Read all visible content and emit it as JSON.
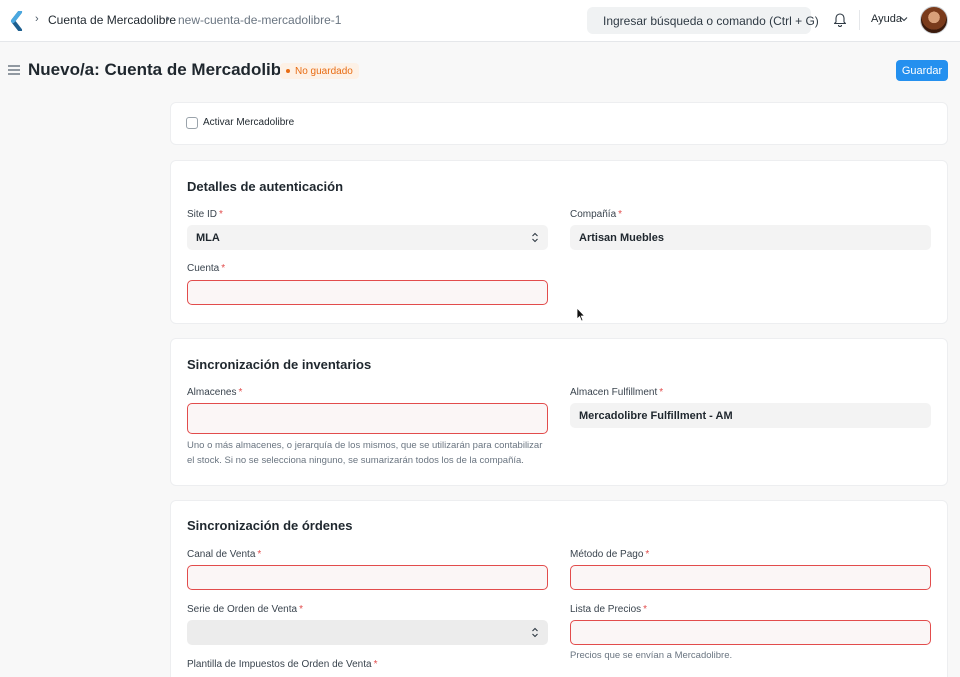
{
  "navbar": {
    "breadcrumbs": [
      "Cuenta de Mercadolibre",
      "new-cuenta-de-mercadolibre-1"
    ],
    "search_placeholder": "Ingresar búsqueda o comando (Ctrl + G)",
    "help_label": "Ayuda"
  },
  "header": {
    "title": "Nuevo/a: Cuenta de Mercadolibre",
    "status": "No guardado",
    "save_label": "Guardar"
  },
  "activate": {
    "label": "Activar Mercadolibre",
    "checked": false
  },
  "auth_section": {
    "title": "Detalles de autenticación",
    "site_id": {
      "label": "Site ID",
      "value": "MLA"
    },
    "company": {
      "label": "Compañía",
      "value": "Artisan Muebles"
    },
    "account": {
      "label": "Cuenta",
      "value": ""
    }
  },
  "inventory_section": {
    "title": "Sincronización de inventarios",
    "warehouses": {
      "label": "Almacenes",
      "value": "",
      "help": "Uno o más almacenes, o jerarquía de los mismos, que se utilizarán para contabilizar el stock. Si no se selecciona ninguno, se sumarizarán todos los de la compañía."
    },
    "fulfillment": {
      "label": "Almacen Fulfillment",
      "value": "Mercadolibre Fulfillment - AM"
    }
  },
  "orders_section": {
    "title": "Sincronización de órdenes",
    "sales_channel": {
      "label": "Canal de Venta",
      "value": ""
    },
    "payment_method": {
      "label": "Método de Pago",
      "value": ""
    },
    "order_series": {
      "label": "Serie de Orden de Venta",
      "value": ""
    },
    "price_list": {
      "label": "Lista de Precios",
      "value": "",
      "help": "Precios que se envían a Mercadolibre."
    },
    "tax_template": {
      "label": "Plantilla de Impuestos de Orden de Venta",
      "value": ""
    }
  },
  "colors": {
    "primary": "#2490ef",
    "required": "#e24c4c",
    "unsaved": "#e86c13"
  }
}
